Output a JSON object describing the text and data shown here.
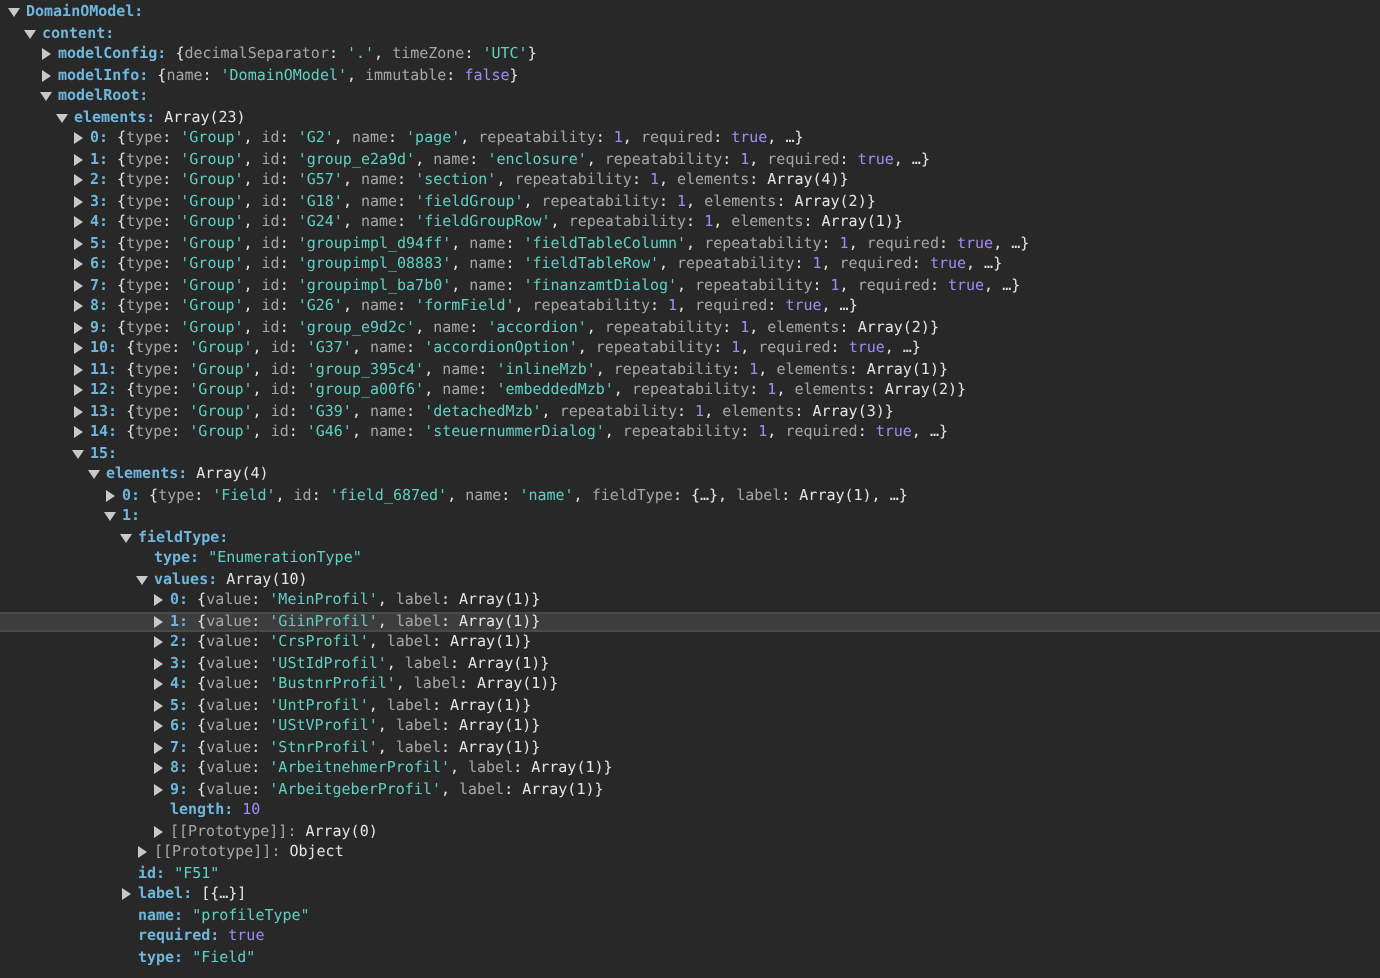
{
  "tree": [
    {
      "key": "DomainOModel:",
      "expanded": true,
      "selected": false,
      "children": [
        {
          "key": "content:",
          "expanded": true,
          "selected": false,
          "children": [
            {
              "key": "modelConfig:",
              "value": "{decimalSeparator: '.', timeZone: 'UTC'}",
              "expanded": false,
              "selected": false
            },
            {
              "key": "modelInfo:",
              "value": "{name: 'DomainOModel', immutable: false}",
              "expanded": false,
              "selected": false
            },
            {
              "key": "modelRoot:",
              "expanded": true,
              "selected": false,
              "children": [
                {
                  "key": "elements:",
                  "value": "Array(23)",
                  "expanded": true,
                  "selected": false,
                  "children": [
                    {
                      "key": "0:",
                      "value": "{type: 'Group', id: 'G2', name: 'page', repeatability: 1, required: true, …}",
                      "expanded": false,
                      "selected": false
                    },
                    {
                      "key": "1:",
                      "value": "{type: 'Group', id: 'group_e2a9d', name: 'enclosure', repeatability: 1, required: true, …}",
                      "expanded": false,
                      "selected": false
                    },
                    {
                      "key": "2:",
                      "value": "{type: 'Group', id: 'G57', name: 'section', repeatability: 1, elements: Array(4)}",
                      "expanded": false,
                      "selected": false
                    },
                    {
                      "key": "3:",
                      "value": "{type: 'Group', id: 'G18', name: 'fieldGroup', repeatability: 1, elements: Array(2)}",
                      "expanded": false,
                      "selected": false
                    },
                    {
                      "key": "4:",
                      "value": "{type: 'Group', id: 'G24', name: 'fieldGroupRow', repeatability: 1, elements: Array(1)}",
                      "expanded": false,
                      "selected": false
                    },
                    {
                      "key": "5:",
                      "value": "{type: 'Group', id: 'groupimpl_d94ff', name: 'fieldTableColumn', repeatability: 1, required: true, …}",
                      "expanded": false,
                      "selected": false
                    },
                    {
                      "key": "6:",
                      "value": "{type: 'Group', id: 'groupimpl_08883', name: 'fieldTableRow', repeatability: 1, required: true, …}",
                      "expanded": false,
                      "selected": false
                    },
                    {
                      "key": "7:",
                      "value": "{type: 'Group', id: 'groupimpl_ba7b0', name: 'finanzamtDialog', repeatability: 1, required: true, …}",
                      "expanded": false,
                      "selected": false
                    },
                    {
                      "key": "8:",
                      "value": "{type: 'Group', id: 'G26', name: 'formField', repeatability: 1, required: true, …}",
                      "expanded": false,
                      "selected": false
                    },
                    {
                      "key": "9:",
                      "value": "{type: 'Group', id: 'group_e9d2c', name: 'accordion', repeatability: 1, elements: Array(2)}",
                      "expanded": false,
                      "selected": false
                    },
                    {
                      "key": "10:",
                      "value": "{type: 'Group', id: 'G37', name: 'accordionOption', repeatability: 1, required: true, …}",
                      "expanded": false,
                      "selected": false
                    },
                    {
                      "key": "11:",
                      "value": "{type: 'Group', id: 'group_395c4', name: 'inlineMzb', repeatability: 1, elements: Array(1)}",
                      "expanded": false,
                      "selected": false
                    },
                    {
                      "key": "12:",
                      "value": "{type: 'Group', id: 'group_a00f6', name: 'embeddedMzb', repeatability: 1, elements: Array(2)}",
                      "expanded": false,
                      "selected": false
                    },
                    {
                      "key": "13:",
                      "value": "{type: 'Group', id: 'G39', name: 'detachedMzb', repeatability: 1, elements: Array(3)}",
                      "expanded": false,
                      "selected": false
                    },
                    {
                      "key": "14:",
                      "value": "{type: 'Group', id: 'G46', name: 'steuernummerDialog', repeatability: 1, required: true, …}",
                      "expanded": false,
                      "selected": false
                    },
                    {
                      "key": "15:",
                      "expanded": true,
                      "selected": false,
                      "children": [
                        {
                          "key": "elements:",
                          "value": "Array(4)",
                          "expanded": true,
                          "selected": false,
                          "children": [
                            {
                              "key": "0:",
                              "value": "{type: 'Field', id: 'field_687ed', name: 'name', fieldType: {…}, label: Array(1), …}",
                              "expanded": false,
                              "selected": false
                            },
                            {
                              "key": "1:",
                              "expanded": true,
                              "selected": false,
                              "children": [
                                {
                                  "key": "fieldType:",
                                  "expanded": true,
                                  "selected": false,
                                  "children": [
                                    {
                                      "key": "type:",
                                      "value": "\"EnumerationType\"",
                                      "selected": false
                                    },
                                    {
                                      "key": "values:",
                                      "value": "Array(10)",
                                      "expanded": true,
                                      "selected": false,
                                      "children": [
                                        {
                                          "key": "0:",
                                          "value": "{value: 'MeinProfil', label: Array(1)}",
                                          "expanded": false,
                                          "selected": false
                                        },
                                        {
                                          "key": "1:",
                                          "value": "{value: 'GiinProfil', label: Array(1)}",
                                          "expanded": false,
                                          "selected": true
                                        },
                                        {
                                          "key": "2:",
                                          "value": "{value: 'CrsProfil', label: Array(1)}",
                                          "expanded": false,
                                          "selected": false
                                        },
                                        {
                                          "key": "3:",
                                          "value": "{value: 'UStIdProfil', label: Array(1)}",
                                          "expanded": false,
                                          "selected": false
                                        },
                                        {
                                          "key": "4:",
                                          "value": "{value: 'BustnrProfil', label: Array(1)}",
                                          "expanded": false,
                                          "selected": false
                                        },
                                        {
                                          "key": "5:",
                                          "value": "{value: 'UntProfil', label: Array(1)}",
                                          "expanded": false,
                                          "selected": false
                                        },
                                        {
                                          "key": "6:",
                                          "value": "{value: 'UStVProfil', label: Array(1)}",
                                          "expanded": false,
                                          "selected": false
                                        },
                                        {
                                          "key": "7:",
                                          "value": "{value: 'StnrProfil', label: Array(1)}",
                                          "expanded": false,
                                          "selected": false
                                        },
                                        {
                                          "key": "8:",
                                          "value": "{value: 'ArbeitnehmerProfil', label: Array(1)}",
                                          "expanded": false,
                                          "selected": false
                                        },
                                        {
                                          "key": "9:",
                                          "value": "{value: 'ArbeitgeberProfil', label: Array(1)}",
                                          "expanded": false,
                                          "selected": false
                                        },
                                        {
                                          "key": "length:",
                                          "value": "10",
                                          "selected": false
                                        },
                                        {
                                          "key": "[[Prototype]]:",
                                          "kind": "internal",
                                          "value": "Array(0)",
                                          "expanded": false,
                                          "selected": false
                                        }
                                      ]
                                    },
                                    {
                                      "key": "[[Prototype]]:",
                                      "kind": "internal",
                                      "value": "Object",
                                      "expanded": false,
                                      "selected": false
                                    }
                                  ]
                                },
                                {
                                  "key": "id:",
                                  "value": "\"F51\"",
                                  "selected": false
                                },
                                {
                                  "key": "label:",
                                  "value": "[{…}]",
                                  "expanded": false,
                                  "selected": false
                                },
                                {
                                  "key": "name:",
                                  "value": "\"profileType\"",
                                  "selected": false
                                },
                                {
                                  "key": "required:",
                                  "value": "true",
                                  "selected": false
                                },
                                {
                                  "key": "type:",
                                  "value": "\"Field\"",
                                  "selected": false
                                }
                              ]
                            }
                          ]
                        }
                      ]
                    }
                  ]
                }
              ]
            }
          ]
        }
      ]
    }
  ]
}
